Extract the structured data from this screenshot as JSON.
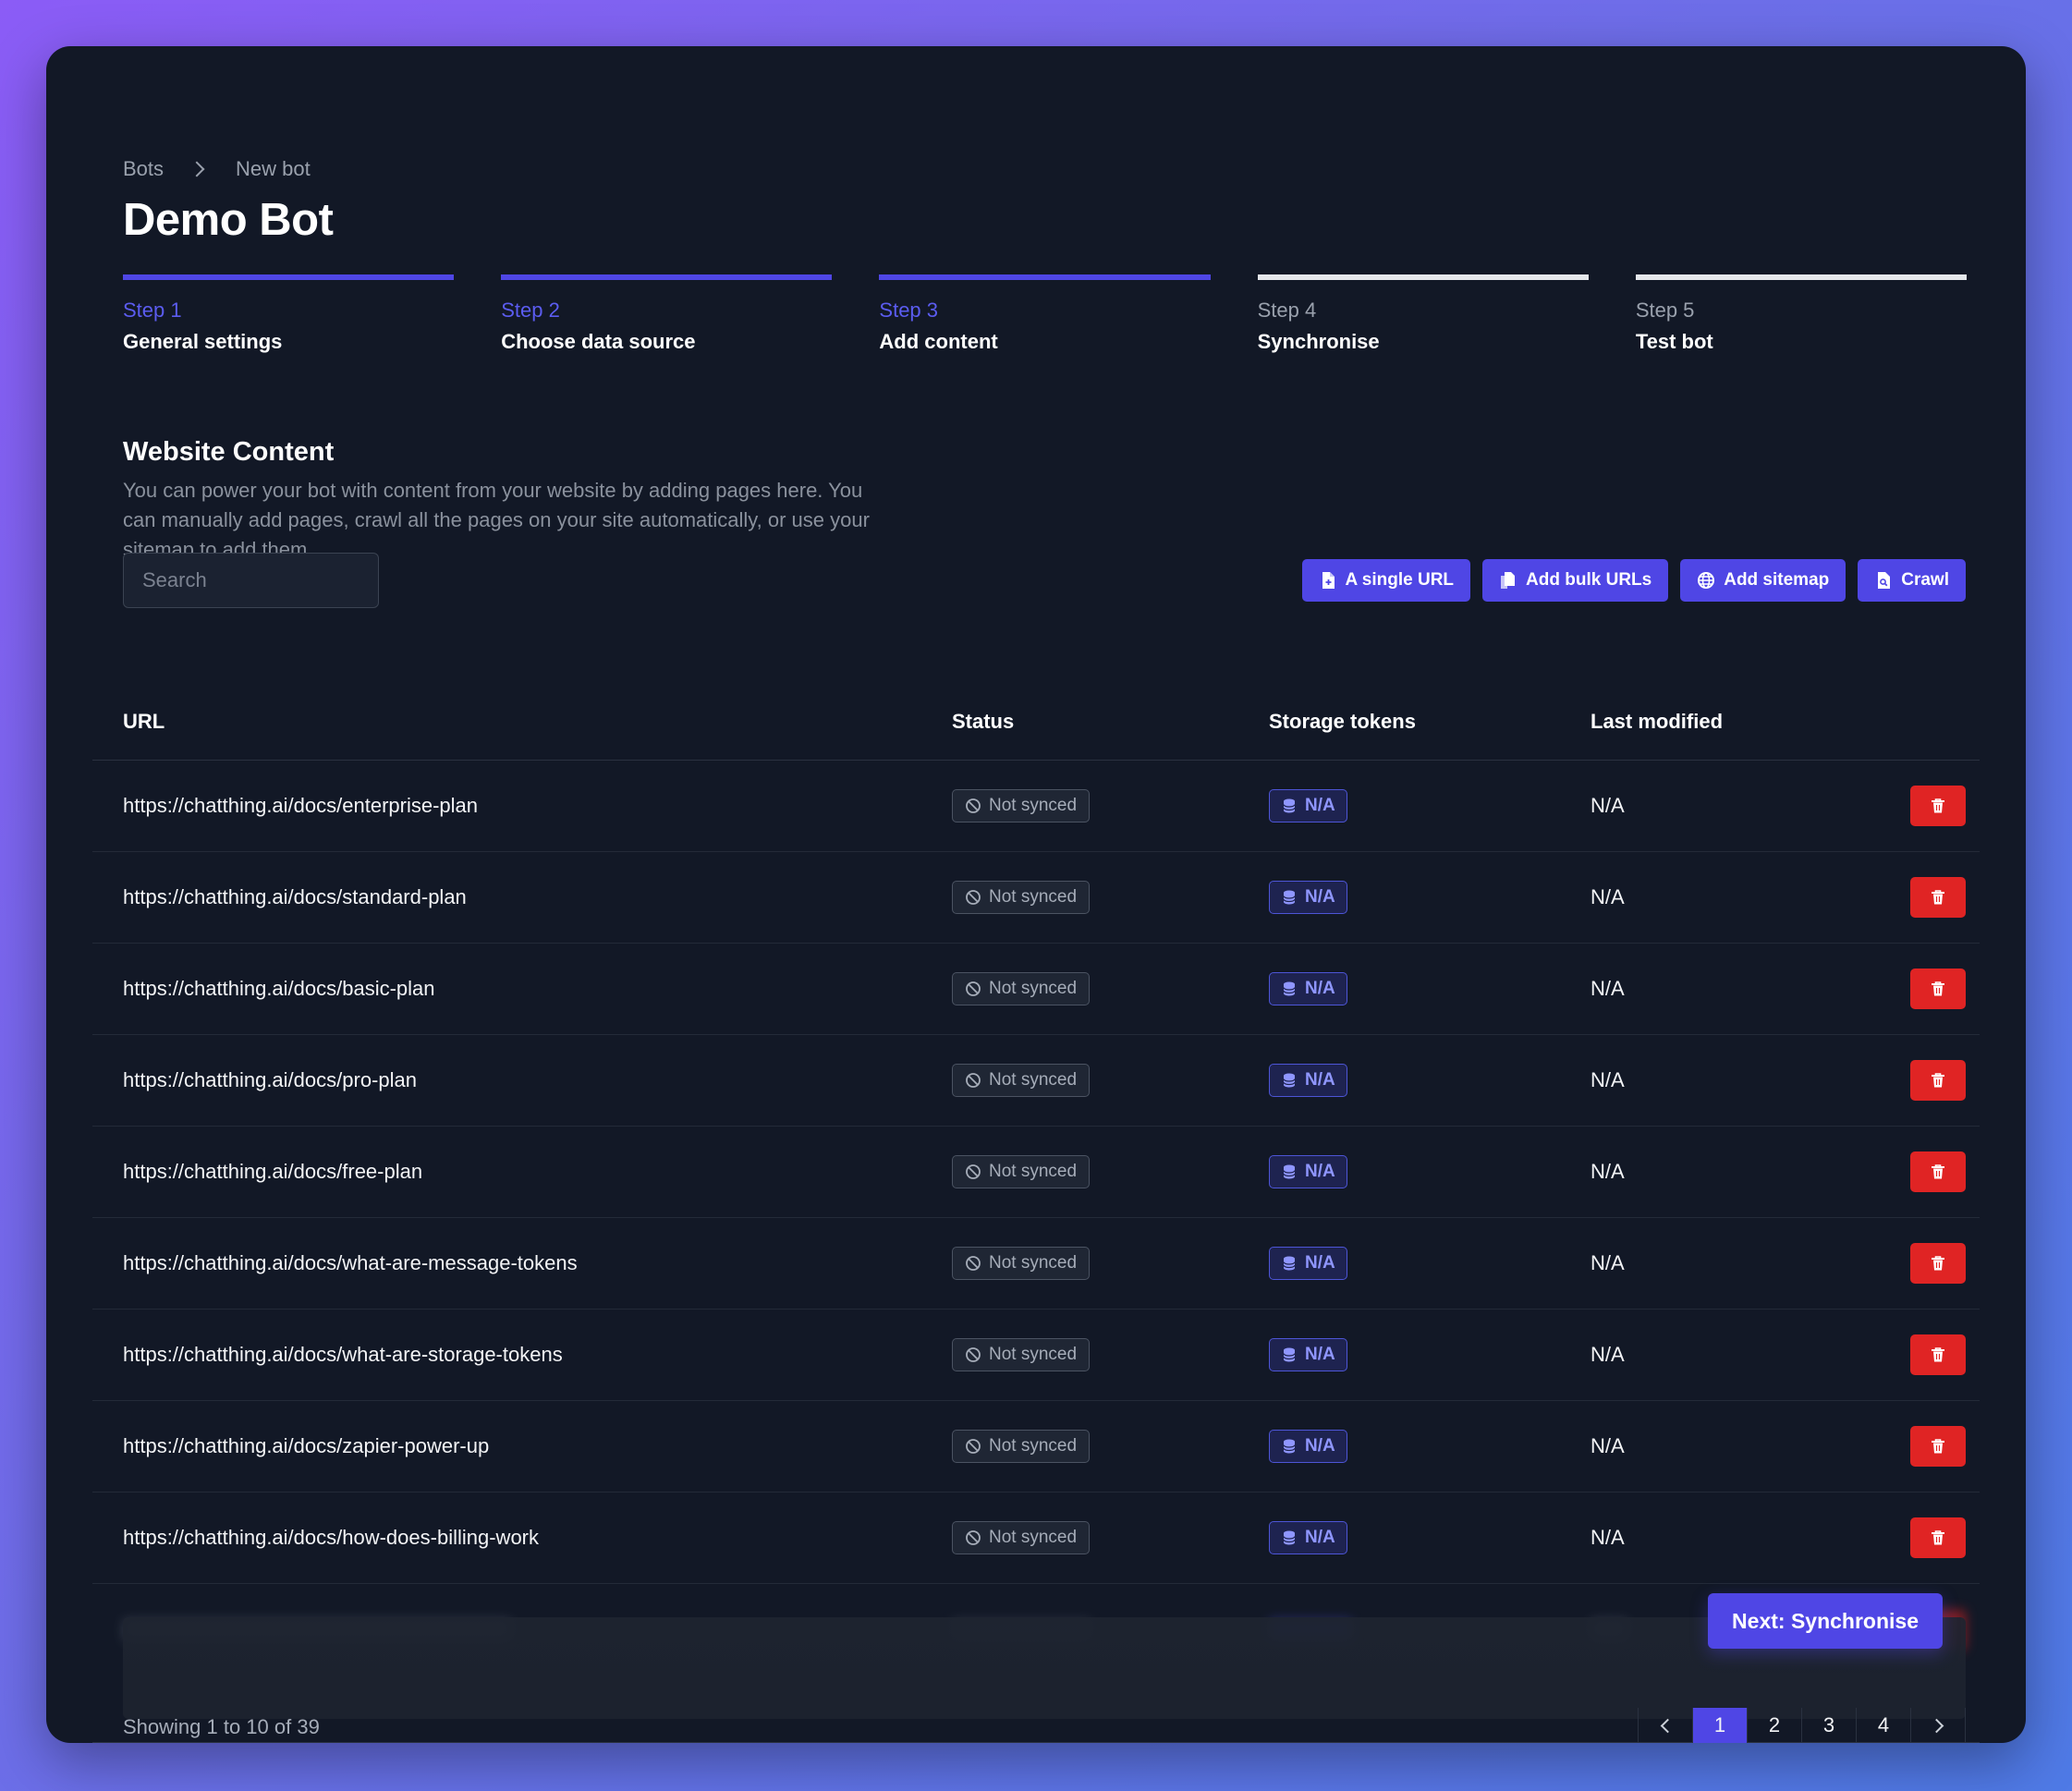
{
  "breadcrumb": {
    "root": "Bots",
    "current": "New bot"
  },
  "page_title": "Demo Bot",
  "steps": [
    {
      "num": "Step 1",
      "label": "General settings",
      "done": true
    },
    {
      "num": "Step 2",
      "label": "Choose data source",
      "done": true
    },
    {
      "num": "Step 3",
      "label": "Add content",
      "done": true
    },
    {
      "num": "Step 4",
      "label": "Synchronise",
      "done": false
    },
    {
      "num": "Step 5",
      "label": "Test bot",
      "done": false
    }
  ],
  "section": {
    "title": "Website Content",
    "description": "You can power your bot with content from your website by adding pages here. You can manually add pages, crawl all the pages on your site automatically, or use your sitemap to add them."
  },
  "search": {
    "placeholder": "Search",
    "value": ""
  },
  "actions": {
    "single_url": "A single URL",
    "bulk_urls": "Add bulk URLs",
    "sitemap": "Add sitemap",
    "crawl": "Crawl"
  },
  "table": {
    "headers": {
      "url": "URL",
      "status": "Status",
      "tokens": "Storage tokens",
      "modified": "Last modified"
    },
    "rows": [
      {
        "url": "https://chatthing.ai/docs/enterprise-plan",
        "status": "Not synced",
        "tokens": "N/A",
        "modified": "N/A"
      },
      {
        "url": "https://chatthing.ai/docs/standard-plan",
        "status": "Not synced",
        "tokens": "N/A",
        "modified": "N/A"
      },
      {
        "url": "https://chatthing.ai/docs/basic-plan",
        "status": "Not synced",
        "tokens": "N/A",
        "modified": "N/A"
      },
      {
        "url": "https://chatthing.ai/docs/pro-plan",
        "status": "Not synced",
        "tokens": "N/A",
        "modified": "N/A"
      },
      {
        "url": "https://chatthing.ai/docs/free-plan",
        "status": "Not synced",
        "tokens": "N/A",
        "modified": "N/A"
      },
      {
        "url": "https://chatthing.ai/docs/what-are-message-tokens",
        "status": "Not synced",
        "tokens": "N/A",
        "modified": "N/A"
      },
      {
        "url": "https://chatthing.ai/docs/what-are-storage-tokens",
        "status": "Not synced",
        "tokens": "N/A",
        "modified": "N/A"
      },
      {
        "url": "https://chatthing.ai/docs/zapier-power-up",
        "status": "Not synced",
        "tokens": "N/A",
        "modified": "N/A"
      },
      {
        "url": "https://chatthing.ai/docs/how-does-billing-work",
        "status": "Not synced",
        "tokens": "N/A",
        "modified": "N/A"
      }
    ]
  },
  "next_button": "Next: Synchronise",
  "pagination": {
    "showing": "Showing 1 to 10 of 39",
    "pages": [
      "1",
      "2",
      "3",
      "4"
    ],
    "current": "1"
  },
  "colors": {
    "accent": "#4f46e5",
    "danger": "#e02424",
    "background": "#121826"
  }
}
